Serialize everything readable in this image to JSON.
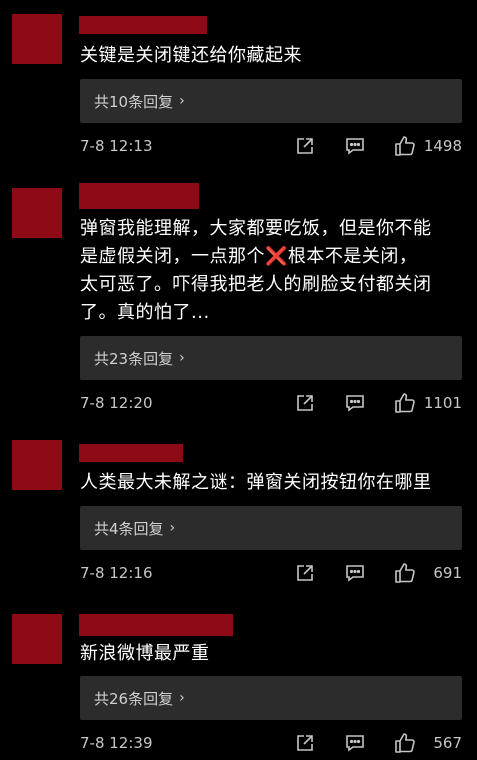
{
  "colors": {
    "background": "#000000",
    "redaction": "#8e0a16",
    "reply_box": "#2c2c2c",
    "meta_text": "#c6c6c6"
  },
  "comments": [
    {
      "text": "关键是关闭键还给你藏起来",
      "replies_label": "共10条回复",
      "time": "7-8 12:13",
      "likes": "1498"
    },
    {
      "text": "弹窗我能理解，大家都要吃饭，但是你不能\n是虚假关闭，一点那个❌根本不是关闭，\n太可恶了。吓得我把老人的刷脸支付都关闭\n了。真的怕了...",
      "replies_label": "共23条回复",
      "time": "7-8 12:20",
      "likes": "1101"
    },
    {
      "text": "人类最大未解之谜：弹窗关闭按钮你在哪里",
      "replies_label": "共4条回复",
      "time": "7-8 12:16",
      "likes": "691"
    },
    {
      "text": "新浪微博最严重",
      "replies_label": "共26条回复",
      "time": "7-8 12:39",
      "likes": "567"
    }
  ],
  "icons": {
    "share": "share-icon",
    "reply": "comment-icon",
    "like": "thumbs-up-icon",
    "chevron": "chevron-right-icon"
  }
}
